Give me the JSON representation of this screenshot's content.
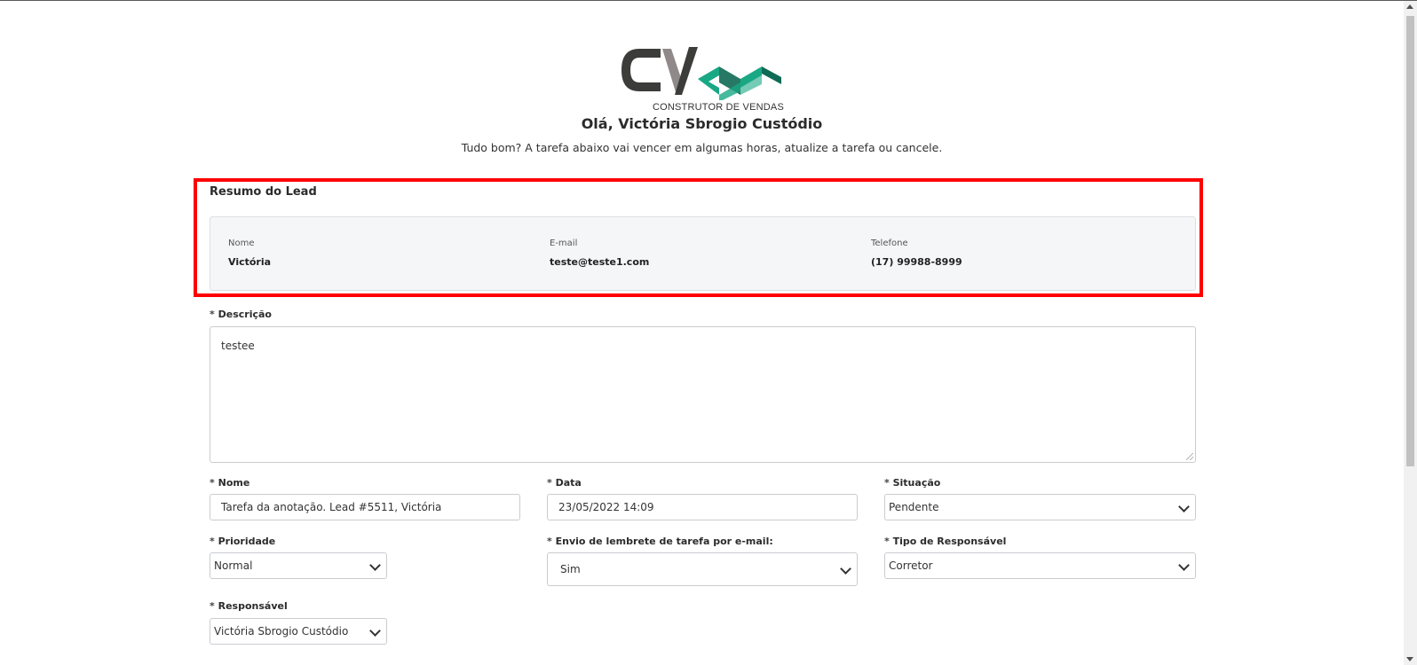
{
  "brand": {
    "logo_text": "CONSTRUTOR DE VENDAS",
    "colors": {
      "dark": "#3c3c3a",
      "gray": "#8f8a89",
      "teal": "#19a884",
      "teal_dark": "#0f6a55"
    }
  },
  "header": {
    "greeting": "Olá, Victória Sbrogio Custódio",
    "intro": "Tudo bom? A tarefa abaixo vai vencer em algumas horas, atualize a tarefa ou cancele."
  },
  "lead_summary": {
    "title": "Resumo do Lead",
    "highlight_color": "#ff0000",
    "name_label": "Nome",
    "name_value": "Victória",
    "email_label": "E-mail",
    "email_value": "teste@teste1.com",
    "phone_label": "Telefone",
    "phone_value": "(17) 99988-8999"
  },
  "form": {
    "required_mark": "*",
    "descricao": {
      "label": "Descrição",
      "value": "testee"
    },
    "nome": {
      "label": "Nome",
      "value": "Tarefa da anotação. Lead #5511, Victória"
    },
    "data": {
      "label": "Data",
      "value": "23/05/2022 14:09"
    },
    "situacao": {
      "label": "Situação",
      "value": "Pendente"
    },
    "prioridade": {
      "label": "Prioridade",
      "value": "Normal"
    },
    "lembrete": {
      "label": "Envio de lembrete de tarefa por e-mail:",
      "value": "Sim"
    },
    "tipo_responsavel": {
      "label": "Tipo de Responsável",
      "value": "Corretor"
    },
    "responsavel": {
      "label": "Responsável",
      "value": "Victória Sbrogio Custódio"
    }
  }
}
